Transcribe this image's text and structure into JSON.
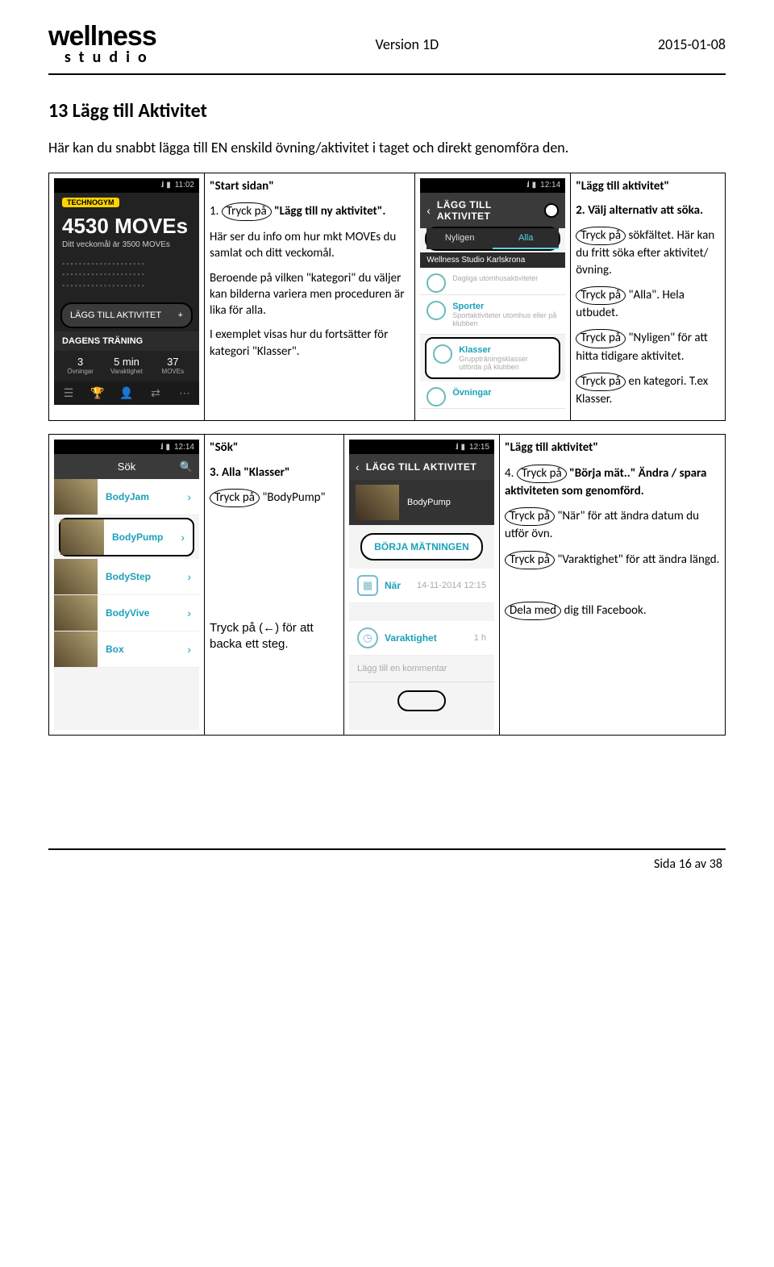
{
  "header": {
    "logo_main": "wellness",
    "logo_sub": "studio",
    "version": "Version 1D",
    "date": "2015-01-08"
  },
  "h1": "13  Lägg till Aktivitet",
  "intro": "Här kan du snabbt lägga till EN enskild övning/aktivitet i taget och direkt genomföra den.",
  "row1": {
    "shot1": {
      "time": "11:02",
      "brand": "TECHNOGYM",
      "moves": "4530 MOVEs",
      "goal": "Ditt veckomål är 3500 MOVEs",
      "add_btn": "LÄGG TILL AKTIVITET",
      "plus": "+",
      "sect": "DAGENS TRÄNING",
      "s1v": "3",
      "s1l": "Övningar",
      "s2v": "5 min",
      "s2l": "Varaktighet",
      "s3v": "37",
      "s3l": "MOVEs"
    },
    "ann1": {
      "title": "\"Start sidan\"",
      "l1a": "1.",
      "l1_ov": "Tryck  på",
      "l1b": "\"Lägg till ny aktivitet\".",
      "p2": "Här ser du info om hur mkt MOVEs du samlat och ditt veckomål.",
      "p3": "Beroende på vilken \"kategori\" du väljer kan bilderna variera men proceduren är lika för alla.",
      "p4": "I exemplet visas hur du fortsätter för kategori \"Klasser\"."
    },
    "shot2": {
      "time": "12:14",
      "hdr": "LÄGG TILL AKTIVITET",
      "tab1": "Nyligen",
      "tab2": "Alla",
      "gym": "Wellness Studio Karlskrona",
      "i1t": "Dagliga utomhusaktiviteter",
      "i2": "Sporter",
      "i2t": "Sportaktiviteter utomhus eller på klubben",
      "i3": "Klasser",
      "i3t": "Gruppträningsklasser utförda på klubben",
      "i4": "Övningar"
    },
    "ann2": {
      "title": "\"Lägg till aktivitet\"",
      "p1": "2. Välj alternativ att söka.",
      "p2_ov": "Tryck  på",
      "p2b": "sökfältet. Här kan du fritt söka efter aktivitet/övning.",
      "p3_ov": "Tryck  på",
      "p3b": "\"Alla\". Hela utbudet.",
      "p4_ov": "Tryck  på",
      "p4b": "\"Nyligen\" för att hitta tidigare aktivitet.",
      "p5_ov": "Tryck  på",
      "p5b": "en kategori. T.ex Klasser."
    }
  },
  "row2": {
    "shot3": {
      "time": "12:14",
      "hdr": "Sök",
      "items": [
        "BodyJam",
        "BodyPump",
        "BodyStep",
        "BodyVive",
        "Box"
      ]
    },
    "ann3": {
      "title": "\"Sök\"",
      "p1": "3. Alla \"Klasser\"",
      "p2_ov": "Tryck på",
      "p2b": "\"BodyPump\"",
      "p3": "Tryck på (←) för att backa ett steg."
    },
    "shot4": {
      "time": "12:15",
      "hdr": "LÄGG TILL AKTIVITET",
      "item": "BodyPump",
      "btn": "BÖRJA MÄTNINGEN",
      "k1": "När",
      "k1v": "14-11-2014 12:15",
      "k2": "Varaktighet",
      "k2v": "1 h",
      "comment": "Lägg till en kommentar"
    },
    "ann4": {
      "title": "\"Lägg till aktivitet\"",
      "p1a": "4.",
      "p1_ov": "Tryck på",
      "p1b": "\"Börja mät..\" Ändra / spara aktiviteten som genomförd.",
      "p2_ov": "Tryck på",
      "p2b": "\"När\" för att ändra datum du utför övn.",
      "p3_ov": "Tryck på",
      "p3b": "\"Varaktighet\" för att ändra längd.",
      "p4_ov": "Dela med",
      "p4b": "dig till  Facebook."
    }
  },
  "footer": "Sida 16 av 38"
}
